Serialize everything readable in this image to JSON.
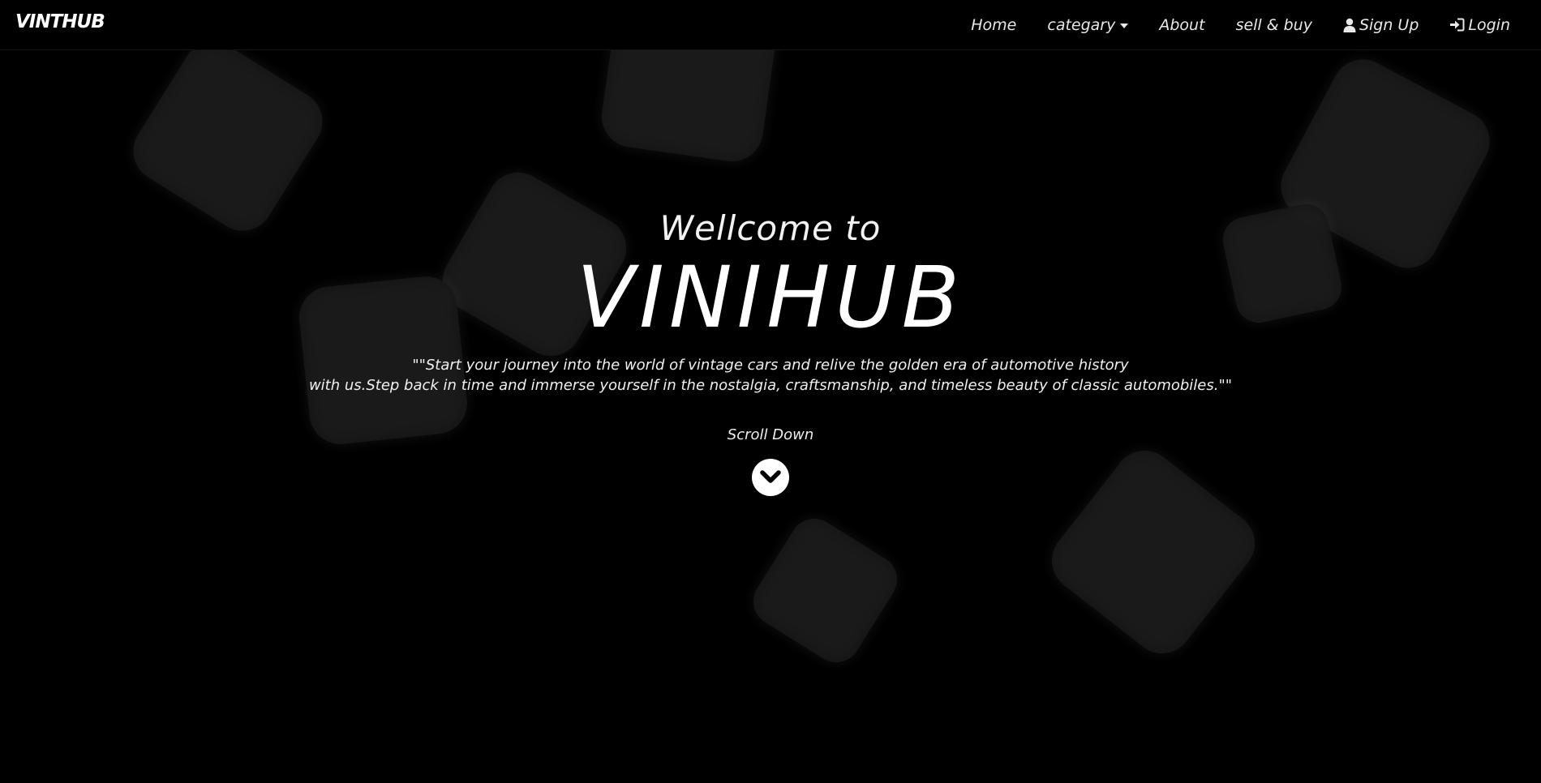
{
  "navbar": {
    "brand": "VINTHUB",
    "items": [
      {
        "label": "Home"
      },
      {
        "label": "categary"
      },
      {
        "label": "About"
      },
      {
        "label": "sell & buy"
      },
      {
        "label": "Sign Up",
        "icon": "user-icon"
      },
      {
        "label": "Login",
        "icon": "login-icon"
      }
    ]
  },
  "hero": {
    "welcome": "Wellcome to",
    "title": "VINIHUB",
    "tagline_line1": "\"\"Start your journey into the world of vintage cars and relive the golden era of automotive history",
    "tagline_line2": "with us.Step back in time and immerse yourself in the nostalgia, craftsmanship, and timeless beauty of classic automobiles.\"\"",
    "scroll_label": "Scroll Down",
    "scroll_icon": "chevron-down-circle-icon"
  },
  "colors": {
    "background": "#000000",
    "text": "#ffffff",
    "squares": "#1d1d1d"
  }
}
